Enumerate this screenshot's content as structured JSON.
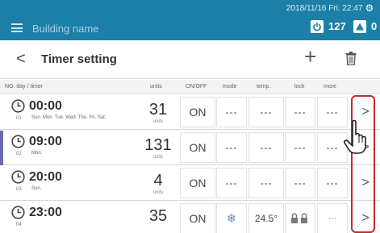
{
  "header": {
    "building_name": "Building name",
    "datetime": "2018/11/16 Fri. 22:47",
    "power_count": "127",
    "alarm_count": "0"
  },
  "titlebar": {
    "back": "<",
    "title": "Timer setting",
    "add": "+"
  },
  "columns": {
    "no_day": "NO.  day / timer",
    "units": "units",
    "onoff": "ON/OFF",
    "mode": "mode",
    "temp": "temp.",
    "lock": "lock",
    "more": "more"
  },
  "rows": [
    {
      "time": "00:00",
      "num": "01",
      "days": "Sun. Mon. Tue. Wed. Thu. Fri. Sat.",
      "units": "31",
      "units_label": "units",
      "onoff": "ON",
      "mode": "---",
      "temp": "---",
      "lock": "---",
      "more": "---",
      "arrow": ">"
    },
    {
      "time": "09:00",
      "num": "02",
      "days": "Mon.",
      "units": "131",
      "units_label": "units",
      "onoff": "ON",
      "mode": "---",
      "temp": "---",
      "lock": "---",
      "more": "---",
      "arrow": ">"
    },
    {
      "time": "20:00",
      "num": "03",
      "days": "Sun.",
      "units": "4",
      "units_label": "units",
      "onoff": "ON",
      "mode": "---",
      "temp": "---",
      "lock": "---",
      "more": "---",
      "arrow": ">"
    },
    {
      "time": "23:00",
      "num": "04",
      "days": "",
      "units": "35",
      "units_label": "",
      "onoff": "ON",
      "mode": "❄",
      "temp": "24.5°",
      "lock": "",
      "more": "···",
      "arrow": ">"
    }
  ],
  "icons": [
    "menu-icon",
    "gear-icon",
    "power-icon",
    "alarm-icon",
    "back-icon",
    "plus-icon",
    "trash-icon",
    "clock-icon",
    "chevron-right-icon",
    "hand-pointer-icon",
    "snowflake-icon",
    "lock-icon"
  ],
  "colors": {
    "header": "#1b7fa8",
    "highlight": "#c62a2a",
    "selected_marker": "#6a6aa8"
  }
}
